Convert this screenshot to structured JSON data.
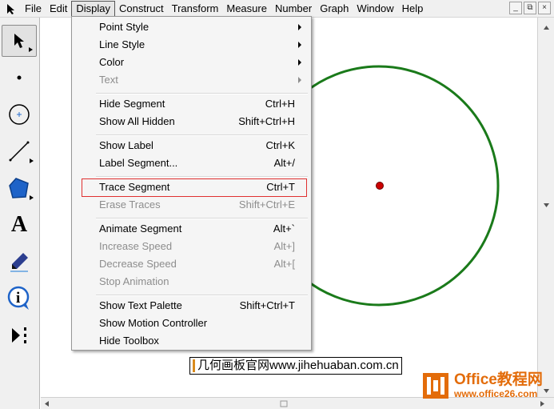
{
  "menubar": {
    "items": [
      "File",
      "Edit",
      "Display",
      "Construct",
      "Transform",
      "Measure",
      "Number",
      "Graph",
      "Window",
      "Help"
    ],
    "active": "Display",
    "window_controls": [
      "_",
      "⧉",
      "×"
    ]
  },
  "display_menu": {
    "items": [
      {
        "label": "Point Style",
        "shortcut": "",
        "submenu": true,
        "disabled": false
      },
      {
        "label": "Line Style",
        "shortcut": "",
        "submenu": true,
        "disabled": false
      },
      {
        "label": "Color",
        "shortcut": "",
        "submenu": true,
        "disabled": false
      },
      {
        "label": "Text",
        "shortcut": "",
        "submenu": true,
        "disabled": true
      },
      {
        "label": "Hide Segment",
        "shortcut": "Ctrl+H",
        "submenu": false,
        "disabled": false
      },
      {
        "label": "Show All Hidden",
        "shortcut": "Shift+Ctrl+H",
        "submenu": false,
        "disabled": false
      },
      {
        "label": "Show Label",
        "shortcut": "Ctrl+K",
        "submenu": false,
        "disabled": false
      },
      {
        "label": "Label Segment...",
        "shortcut": "Alt+/",
        "submenu": false,
        "disabled": false
      },
      {
        "label": "Trace Segment",
        "shortcut": "Ctrl+T",
        "submenu": false,
        "disabled": false
      },
      {
        "label": "Erase Traces",
        "shortcut": "Shift+Ctrl+E",
        "submenu": false,
        "disabled": true
      },
      {
        "label": "Animate Segment",
        "shortcut": "Alt+`",
        "submenu": false,
        "disabled": false
      },
      {
        "label": "Increase Speed",
        "shortcut": "Alt+]",
        "submenu": false,
        "disabled": true
      },
      {
        "label": "Decrease Speed",
        "shortcut": "Alt+[",
        "submenu": false,
        "disabled": true
      },
      {
        "label": "Stop Animation",
        "shortcut": "",
        "submenu": false,
        "disabled": true
      },
      {
        "label": "Show Text Palette",
        "shortcut": "Shift+Ctrl+T",
        "submenu": false,
        "disabled": false
      },
      {
        "label": "Show Motion Controller",
        "shortcut": "",
        "submenu": false,
        "disabled": false
      },
      {
        "label": "Hide Toolbox",
        "shortcut": "",
        "submenu": false,
        "disabled": false
      }
    ],
    "highlighted": "Trace Segment"
  },
  "toolbox": {
    "tools": [
      "arrow-select-tool",
      "point-tool",
      "compass-tool",
      "straightedge-tool",
      "polygon-tool",
      "text-tool",
      "marker-tool",
      "information-tool",
      "custom-tool"
    ],
    "text_tool_glyph": "A",
    "info_tool_glyph": "i"
  },
  "watermark": {
    "text": "几何画板官网www.jihehuaban.com.cn"
  },
  "logo": {
    "title": "Office教程网",
    "url": "www.office26.com"
  },
  "colors": {
    "circle": "#1a7a1a",
    "center_point": "#cc0000",
    "highlight_border": "#e03030",
    "logo_orange": "#e36c0a"
  }
}
